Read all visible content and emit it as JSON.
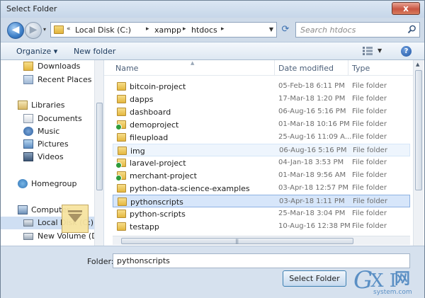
{
  "window": {
    "title": "Select Folder",
    "close_glyph": "x"
  },
  "address": {
    "crumbs": [
      "Local Disk (C:)",
      "xampp",
      "htdocs"
    ],
    "overflow": "«",
    "separator": "▸"
  },
  "search": {
    "placeholder": "Search htdocs"
  },
  "toolbar": {
    "organize": "Organize ▾",
    "new_folder": "New folder",
    "help": "?"
  },
  "nav": {
    "items": [
      {
        "label": "Downloads",
        "icon": "folder-icon"
      },
      {
        "label": "Recent Places",
        "icon": "recent-places-icon"
      },
      {
        "label": "Libraries",
        "icon": "libraries-icon"
      },
      {
        "label": "Documents",
        "icon": "documents-icon"
      },
      {
        "label": "Music",
        "icon": "music-icon"
      },
      {
        "label": "Pictures",
        "icon": "pictures-icon"
      },
      {
        "label": "Videos",
        "icon": "videos-icon"
      },
      {
        "label": "Homegroup",
        "icon": "homegroup-icon"
      },
      {
        "label": "Computer",
        "icon": "computer-icon"
      },
      {
        "label": "Local Disk (C:)",
        "icon": "drive-icon",
        "selected": true
      },
      {
        "label": "New Volume (D:)",
        "icon": "drive-icon"
      }
    ]
  },
  "columns": {
    "name": "Name",
    "date": "Date modified",
    "type": "Type"
  },
  "files": [
    {
      "name": "bitcoin-project",
      "date": "05-Feb-18 6:11 PM",
      "type": "File folder"
    },
    {
      "name": "dapps",
      "date": "17-Mar-18 1:20 PM",
      "type": "File folder"
    },
    {
      "name": "dashboard",
      "date": "06-Aug-16 5:16 PM",
      "type": "File folder"
    },
    {
      "name": "demoproject",
      "date": "01-Mar-18 10:16 PM",
      "type": "File folder"
    },
    {
      "name": "fileupload",
      "date": "25-Aug-16 11:09 A...",
      "type": "File folder"
    },
    {
      "name": "img",
      "date": "06-Aug-16 5:16 PM",
      "type": "File folder"
    },
    {
      "name": "laravel-project",
      "date": "04-Jan-18 3:53 PM",
      "type": "File folder"
    },
    {
      "name": "merchant-project",
      "date": "01-Mar-18 9:56 AM",
      "type": "File folder"
    },
    {
      "name": "python-data-science-examples",
      "date": "03-Apr-18 12:57 PM",
      "type": "File folder"
    },
    {
      "name": "pythonscripts",
      "date": "03-Apr-18 1:11 PM",
      "type": "File folder"
    },
    {
      "name": "python-scripts",
      "date": "25-Mar-18 3:04 PM",
      "type": "File folder"
    },
    {
      "name": "testapp",
      "date": "10-Aug-16 12:38 PM",
      "type": "File folder"
    }
  ],
  "bottom": {
    "folder_label": "Folder:",
    "folder_value": "pythonscripts",
    "select_button": "Select Folder"
  },
  "watermark": {
    "g": "G",
    "xi": "X I",
    "cn": "网",
    "sub": "system.com"
  },
  "colors": {
    "accent": "#3c7fb1",
    "selection": "#d7e6fa",
    "folder": "#e4b73f",
    "close": "#c85542"
  }
}
